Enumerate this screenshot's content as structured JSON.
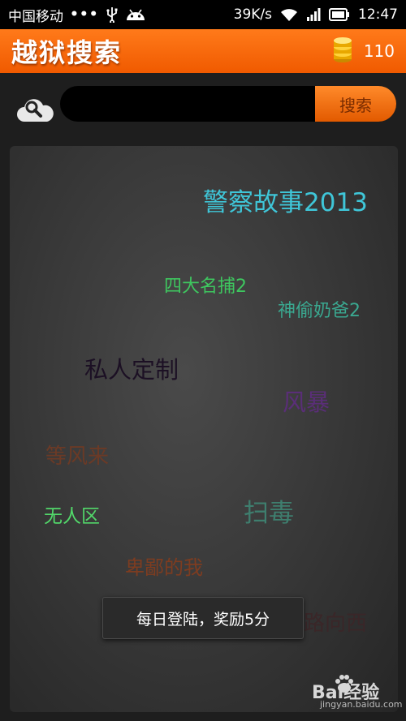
{
  "status_bar": {
    "carrier": "中国移动",
    "dots": "•••",
    "speed": "39K/s",
    "time": "12:47",
    "icons": [
      "usb-icon",
      "android-icon",
      "wifi-icon",
      "signal-icon",
      "battery-icon"
    ]
  },
  "header": {
    "title": "越狱搜索",
    "coins_icon": "coins-icon",
    "coins_count": "110"
  },
  "search": {
    "icon": "cloud-search-icon",
    "placeholder": "",
    "value": "",
    "button_label": "搜索"
  },
  "cloud_tags": [
    {
      "label": "警察故事2013",
      "color": "#3fc6d8"
    },
    {
      "label": "四大名捕2",
      "color": "#3ec75f"
    },
    {
      "label": "神偷奶爸2",
      "color": "#3aa890"
    },
    {
      "label": "私人定制",
      "color": "#1c1024"
    },
    {
      "label": "风暴",
      "color": "#5a2e78"
    },
    {
      "label": "等风来",
      "color": "#6b3a26"
    },
    {
      "label": "无人区",
      "color": "#52d86a"
    },
    {
      "label": "扫毒",
      "color": "#3e7e6e"
    },
    {
      "label": "卑鄙的我",
      "color": "#7e3c20"
    },
    {
      "label": "路向西",
      "color": "#3a2628"
    }
  ],
  "toast": {
    "message": "每日登陆，奖励5分"
  },
  "watermark": {
    "brand": "Bai经验",
    "sub": "jingyan.baidu.com",
    "icon": "baidu-paw-icon"
  },
  "colors": {
    "header_orange": "#f46a08",
    "button_orange": "#ff7a1a",
    "background": "#1e1e1e"
  }
}
